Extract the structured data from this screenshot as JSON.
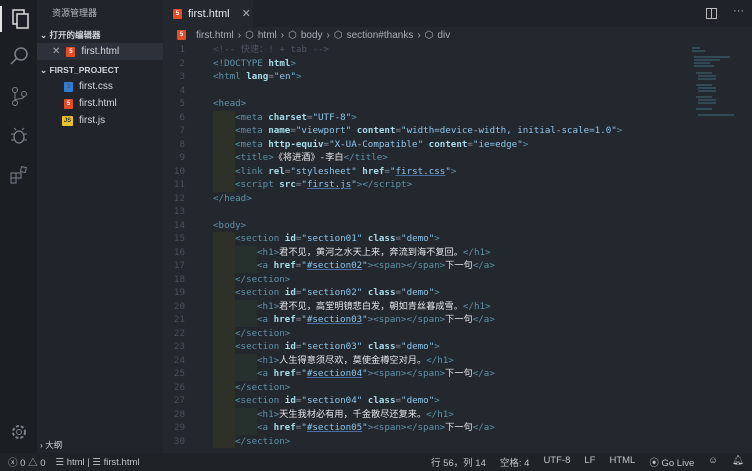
{
  "sidebar": {
    "title": "资源管理器",
    "open_editors": "打开的编辑器",
    "open_file": "first.html",
    "project": "FIRST_PROJECT",
    "files": [
      {
        "name": "first.css",
        "type": "css"
      },
      {
        "name": "first.html",
        "type": "html"
      },
      {
        "name": "first.js",
        "type": "js"
      }
    ],
    "outline": "大纲"
  },
  "tab": {
    "label": "first.html"
  },
  "breadcrumb": [
    "first.html",
    "html",
    "body",
    "section#thanks",
    "div"
  ],
  "code": [
    [
      0,
      [
        [
          "c",
          "<!-- 快速：! + tab -->"
        ]
      ]
    ],
    [
      0,
      [
        [
          "t",
          "<!DOCTYPE "
        ],
        [
          "a",
          "html"
        ],
        [
          "t",
          ">"
        ]
      ]
    ],
    [
      0,
      [
        [
          "t",
          "<html "
        ],
        [
          "a",
          "lang"
        ],
        [
          "p",
          "="
        ],
        [
          "s",
          "\"en\""
        ],
        [
          "t",
          ">"
        ]
      ]
    ],
    [
      0,
      []
    ],
    [
      0,
      [
        [
          "t",
          "<head>"
        ]
      ]
    ],
    [
      1,
      [
        [
          "t",
          "<meta "
        ],
        [
          "a",
          "charset"
        ],
        [
          "p",
          "="
        ],
        [
          "s",
          "\"UTF-8\""
        ],
        [
          "t",
          ">"
        ]
      ]
    ],
    [
      1,
      [
        [
          "t",
          "<meta "
        ],
        [
          "a",
          "name"
        ],
        [
          "p",
          "="
        ],
        [
          "s",
          "\"viewport\" "
        ],
        [
          "a",
          "content"
        ],
        [
          "p",
          "="
        ],
        [
          "s",
          "\"width=device-width, initial-scale=1.0\""
        ],
        [
          "t",
          ">"
        ]
      ]
    ],
    [
      1,
      [
        [
          "t",
          "<meta "
        ],
        [
          "a",
          "http-equiv"
        ],
        [
          "p",
          "="
        ],
        [
          "s",
          "\"X-UA-Compatible\" "
        ],
        [
          "a",
          "content"
        ],
        [
          "p",
          "="
        ],
        [
          "s",
          "\"ie=edge\""
        ],
        [
          "t",
          ">"
        ]
      ]
    ],
    [
      1,
      [
        [
          "t",
          "<title>"
        ],
        [
          "x",
          "《将进酒》-李白"
        ],
        [
          "t",
          "</title>"
        ]
      ]
    ],
    [
      1,
      [
        [
          "t",
          "<link "
        ],
        [
          "a",
          "rel"
        ],
        [
          "p",
          "="
        ],
        [
          "s",
          "\"stylesheet\" "
        ],
        [
          "a",
          "href"
        ],
        [
          "p",
          "="
        ],
        [
          "s",
          "\""
        ],
        [
          "l",
          "first.css"
        ],
        [
          "s",
          "\""
        ],
        [
          "t",
          ">"
        ]
      ]
    ],
    [
      1,
      [
        [
          "t",
          "<script "
        ],
        [
          "a",
          "src"
        ],
        [
          "p",
          "="
        ],
        [
          "s",
          "\""
        ],
        [
          "l",
          "first.js"
        ],
        [
          "s",
          "\""
        ],
        [
          "t",
          "></script>"
        ]
      ]
    ],
    [
      0,
      [
        [
          "t",
          "</head>"
        ]
      ]
    ],
    [
      0,
      []
    ],
    [
      0,
      [
        [
          "t",
          "<body>"
        ]
      ]
    ],
    [
      1,
      [
        [
          "t",
          "<section "
        ],
        [
          "a",
          "id"
        ],
        [
          "p",
          "="
        ],
        [
          "s",
          "\"section01\" "
        ],
        [
          "a",
          "class"
        ],
        [
          "p",
          "="
        ],
        [
          "s",
          "\"demo\""
        ],
        [
          "t",
          ">"
        ]
      ]
    ],
    [
      2,
      [
        [
          "t",
          "<h1>"
        ],
        [
          "x",
          "君不见，黄河之水天上来，奔流到海不复回。"
        ],
        [
          "t",
          "</h1>"
        ]
      ]
    ],
    [
      2,
      [
        [
          "t",
          "<a "
        ],
        [
          "a",
          "href"
        ],
        [
          "p",
          "="
        ],
        [
          "s",
          "\""
        ],
        [
          "l",
          "#section02"
        ],
        [
          "s",
          "\""
        ],
        [
          "t",
          "><span></span>"
        ],
        [
          "x",
          "下一句"
        ],
        [
          "t",
          "</a>"
        ]
      ]
    ],
    [
      1,
      [
        [
          "t",
          "</section>"
        ]
      ]
    ],
    [
      1,
      [
        [
          "t",
          "<section "
        ],
        [
          "a",
          "id"
        ],
        [
          "p",
          "="
        ],
        [
          "s",
          "\"section02\" "
        ],
        [
          "a",
          "class"
        ],
        [
          "p",
          "="
        ],
        [
          "s",
          "\"demo\""
        ],
        [
          "t",
          ">"
        ]
      ]
    ],
    [
      2,
      [
        [
          "t",
          "<h1>"
        ],
        [
          "x",
          "君不见，高堂明镜悲白发，朝如青丝暮成雪。"
        ],
        [
          "t",
          "</h1>"
        ]
      ]
    ],
    [
      2,
      [
        [
          "t",
          "<a "
        ],
        [
          "a",
          "href"
        ],
        [
          "p",
          "="
        ],
        [
          "s",
          "\""
        ],
        [
          "l",
          "#section03"
        ],
        [
          "s",
          "\""
        ],
        [
          "t",
          "><span></span>"
        ],
        [
          "x",
          "下一句"
        ],
        [
          "t",
          "</a>"
        ]
      ]
    ],
    [
      1,
      [
        [
          "t",
          "</section>"
        ]
      ]
    ],
    [
      1,
      [
        [
          "t",
          "<section "
        ],
        [
          "a",
          "id"
        ],
        [
          "p",
          "="
        ],
        [
          "s",
          "\"section03\" "
        ],
        [
          "a",
          "class"
        ],
        [
          "p",
          "="
        ],
        [
          "s",
          "\"demo\""
        ],
        [
          "t",
          ">"
        ]
      ]
    ],
    [
      2,
      [
        [
          "t",
          "<h1>"
        ],
        [
          "x",
          "人生得意须尽欢，莫使金樽空对月。"
        ],
        [
          "t",
          "</h1>"
        ]
      ]
    ],
    [
      2,
      [
        [
          "t",
          "<a "
        ],
        [
          "a",
          "href"
        ],
        [
          "p",
          "="
        ],
        [
          "s",
          "\""
        ],
        [
          "l",
          "#section04"
        ],
        [
          "s",
          "\""
        ],
        [
          "t",
          "><span></span>"
        ],
        [
          "x",
          "下一句"
        ],
        [
          "t",
          "</a>"
        ]
      ]
    ],
    [
      1,
      [
        [
          "t",
          "</section>"
        ]
      ]
    ],
    [
      1,
      [
        [
          "t",
          "<section "
        ],
        [
          "a",
          "id"
        ],
        [
          "p",
          "="
        ],
        [
          "s",
          "\"section04\" "
        ],
        [
          "a",
          "class"
        ],
        [
          "p",
          "="
        ],
        [
          "s",
          "\"demo\""
        ],
        [
          "t",
          ">"
        ]
      ]
    ],
    [
      2,
      [
        [
          "t",
          "<h1>"
        ],
        [
          "x",
          "天生我材必有用，千金散尽还复来。"
        ],
        [
          "t",
          "</h1>"
        ]
      ]
    ],
    [
      2,
      [
        [
          "t",
          "<a "
        ],
        [
          "a",
          "href"
        ],
        [
          "p",
          "="
        ],
        [
          "s",
          "\""
        ],
        [
          "l",
          "#section05"
        ],
        [
          "s",
          "\""
        ],
        [
          "t",
          "><span></span>"
        ],
        [
          "x",
          "下一句"
        ],
        [
          "t",
          "</a>"
        ]
      ]
    ],
    [
      1,
      [
        [
          "t",
          "</section>"
        ]
      ]
    ]
  ],
  "status": {
    "errors": "0",
    "warnings": "0",
    "lang_crumb": "html",
    "file_crumb": "first.html",
    "position": "行 56，列 14",
    "indent": "空格: 4",
    "encoding": "UTF-8",
    "eol": "LF",
    "language": "HTML",
    "golive": "Go Live"
  }
}
